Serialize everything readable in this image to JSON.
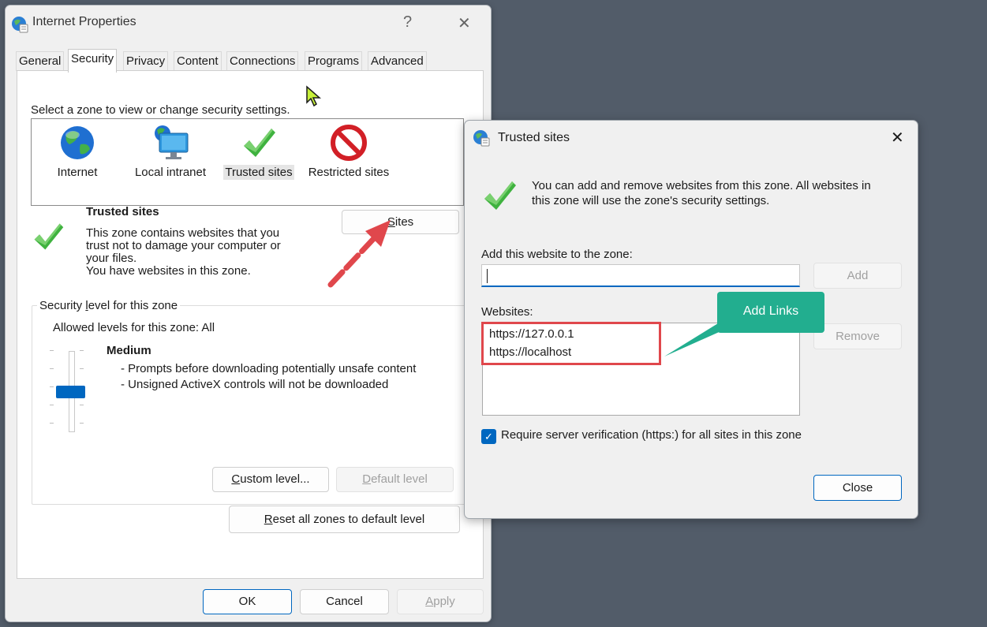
{
  "colors": {
    "desktop": "#525c69",
    "accent": "#0067c0",
    "callout": "#22ae8f",
    "annotation": "#e0474c"
  },
  "internet_properties": {
    "title": "Internet Properties",
    "help_glyph": "?",
    "close_glyph": "✕",
    "tabs": [
      "General",
      "Security",
      "Privacy",
      "Content",
      "Connections",
      "Programs",
      "Advanced"
    ],
    "active_tab": "Security",
    "zone_prompt": "Select a zone to view or change security settings.",
    "zones": [
      {
        "label": "Internet",
        "icon": "globe-icon"
      },
      {
        "label": "Local intranet",
        "icon": "intranet-monitor-icon"
      },
      {
        "label": "Trusted sites",
        "icon": "checkmark-icon"
      },
      {
        "label": "Restricted sites",
        "icon": "no-entry-icon"
      }
    ],
    "selected_zone": "Trusted sites",
    "zone_heading": "Trusted sites",
    "zone_desc": [
      "This zone contains websites that you",
      "trust not to damage your computer or",
      "your files."
    ],
    "zone_note": "You have websites in this zone.",
    "sites_button": {
      "accel": "S",
      "rest": "ites"
    },
    "security_group": {
      "pre": "Security ",
      "accel": "l",
      "post": "evel for this zone"
    },
    "allowed_levels": "Allowed levels for this zone: All",
    "level_name": "Medium",
    "level_bullets": [
      "- Prompts before downloading potentially unsafe content",
      "- Unsigned ActiveX controls will not be downloaded"
    ],
    "custom_level": {
      "accel": "C",
      "rest": "ustom level..."
    },
    "default_level": {
      "accel": "D",
      "rest": "efault level"
    },
    "reset_zones": {
      "accel": "R",
      "rest": "eset all zones to default level"
    },
    "ok": "OK",
    "cancel": "Cancel",
    "apply": {
      "accel": "A",
      "rest": "pply"
    }
  },
  "trusted_sites": {
    "title": "Trusted sites",
    "close_glyph": "✕",
    "info_lines": [
      "You can add and remove websites from this zone. All websites in",
      "this zone will use the zone's security settings."
    ],
    "add_label": "Add this website to the zone:",
    "add_input_value": "",
    "add_button": "Add",
    "websites_label": "Websites:",
    "websites": [
      "https://127.0.0.1",
      "https://localhost"
    ],
    "remove_button": "Remove",
    "require_verification": {
      "checked": true,
      "label": "Require server verification (https:) for all sites in this zone"
    },
    "close_button": "Close"
  },
  "annotation": {
    "callout": "Add Links"
  }
}
